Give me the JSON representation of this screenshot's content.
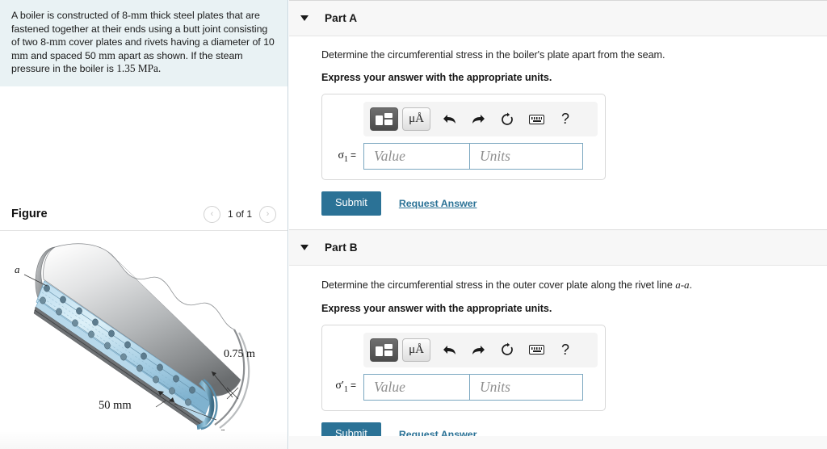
{
  "problem": {
    "statement_parts": [
      {
        "t": "A boiler is constructed of 8-",
        "serif": false
      },
      {
        "t": "mm",
        "serif": true
      },
      {
        "t": " thick steel plates that are fastened together at their ends using a butt joint consisting of two 8-",
        "serif": false
      },
      {
        "t": "mm",
        "serif": true
      },
      {
        "t": " cover plates and rivets having a diameter of 10 ",
        "serif": false
      },
      {
        "t": "mm",
        "serif": true
      },
      {
        "t": " and spaced 50 ",
        "serif": false
      },
      {
        "t": "mm",
        "serif": true
      },
      {
        "t": " apart as shown. If the steam pressure in the boiler is ",
        "serif": false
      },
      {
        "t": "1.35 MPa.",
        "serif": true
      }
    ],
    "plain_text": "A boiler is constructed of 8-mm thick steel plates that are fastened together at their ends using a butt joint consisting of two 8-mm cover plates and rivets having a diameter of 10 mm and spaced 50 mm apart as shown. If the steam pressure in the boiler is 1.35 MPa."
  },
  "figure": {
    "title": "Figure",
    "pager": {
      "prev_icon": "chevron-left-icon",
      "next_icon": "chevron-right-icon",
      "label": "1 of 1",
      "prev_glyph": "‹",
      "next_glyph": "›"
    },
    "labels": {
      "section_top": "a",
      "section_bottom": "a",
      "radius": "0.75 m",
      "spacing": "50 mm"
    },
    "colors": {
      "steel_light": "#e8e9ea",
      "steel_dark": "#7d7f81",
      "plate_blue": "#a9d3e8",
      "plate_blue_light": "#d8ecf6",
      "rivet": "#5d7c8e"
    }
  },
  "parts": [
    {
      "id": "part-a",
      "caret_icon": "caret-down-icon",
      "title": "Part A",
      "prompt_before": "Determine the circumferential stress in the boiler's plate apart from the seam.",
      "prompt_italic": "",
      "prompt_after": "",
      "express": "Express your answer with the appropriate units.",
      "variable": "σ",
      "variable_sub": "1",
      "variable_prime": "",
      "equals": "=",
      "value_placeholder": "Value",
      "units_placeholder": "Units",
      "value": "",
      "units": "",
      "submit_label": "Submit",
      "request_label": "Request Answer"
    },
    {
      "id": "part-b",
      "caret_icon": "caret-down-icon",
      "title": "Part B",
      "prompt_before": "Determine the circumferential stress in the outer cover plate along the rivet line ",
      "prompt_italic": "a-a",
      "prompt_after": ".",
      "express": "Express your answer with the appropriate units.",
      "variable": "σ",
      "variable_sub": "1",
      "variable_prime": "′",
      "equals": "=",
      "value_placeholder": "Value",
      "units_placeholder": "Units",
      "value": "",
      "units": "",
      "submit_label": "Submit",
      "request_label": "Request Answer"
    }
  ],
  "mathbar": {
    "template_button_label": "template-icon",
    "units_button_label": "μÅ",
    "undo_glyph": "⬅",
    "redo_glyph": "➡",
    "reset_glyph": "↻",
    "keyboard_label": "keyboard-icon",
    "help_glyph": "?"
  },
  "colors": {
    "accent": "#2b7296",
    "problem_bg": "#e9f2f4",
    "header_bg": "#f7f7f7",
    "field_border": "#7ba7c0"
  }
}
